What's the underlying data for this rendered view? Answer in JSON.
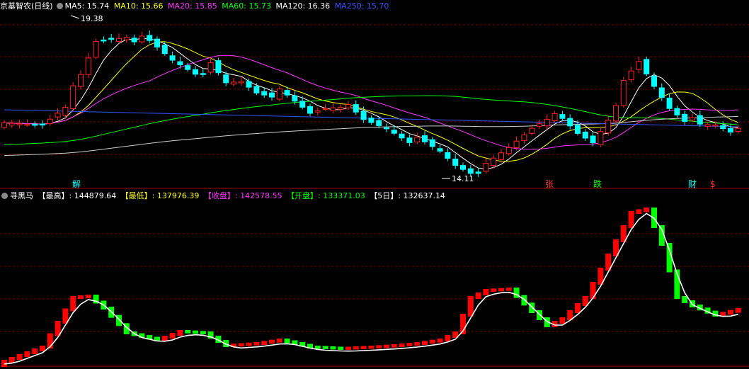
{
  "header_top": {
    "stock_name": "京基智农(日线)",
    "ma_labels": [
      {
        "text": "MA5: 15.74",
        "color": "#ffffff"
      },
      {
        "text": "MA10: 15.66",
        "color": "#ffff00"
      },
      {
        "text": "MA20: 15.85",
        "color": "#ff33ff"
      },
      {
        "text": "MA60: 15.73",
        "color": "#00ff00"
      },
      {
        "text": "MA120: 16.36",
        "color": "#ffffff"
      },
      {
        "text": "MA250: 15.70",
        "color": "#3355ff"
      }
    ]
  },
  "header_bottom": {
    "indicator_name": "寻黑马",
    "stats": [
      {
        "text": "【最高】: 144879.64",
        "color": "#ffffff"
      },
      {
        "text": "【最低】: 137976.39",
        "color": "#ffff00"
      },
      {
        "text": "【收盘】: 142578.55",
        "color": "#ff33ff"
      },
      {
        "text": "【开盘】: 133371.03",
        "color": "#00ff00"
      },
      {
        "text": "【5日】: 132637.14",
        "color": "#ffffff"
      }
    ]
  },
  "colors": {
    "up": "#ff2222",
    "down": "#00ffff",
    "ind_up": "#ff0000",
    "ind_down": "#00ff00",
    "grid": "#7a0000",
    "axis": "#aa0000"
  },
  "chart_data": [
    {
      "type": "candlestick",
      "series": [
        {
          "name": "MA5"
        },
        {
          "name": "MA10"
        },
        {
          "name": "MA20"
        },
        {
          "name": "MA60"
        },
        {
          "name": "MA120"
        },
        {
          "name": "MA250"
        }
      ],
      "annotations": [
        "19.38",
        "14.11"
      ],
      "event_labels": [
        {
          "text": "解",
          "color": "#00ffff"
        },
        {
          "text": "张",
          "color": "#ff3333"
        },
        {
          "text": "跌",
          "color": "#00ff00"
        },
        {
          "text": "财",
          "color": "#00ffff"
        },
        {
          "text": "$",
          "color": "#ff3333"
        }
      ],
      "grid": true
    },
    {
      "type": "bar",
      "title": "寻黑马",
      "grid": true
    }
  ]
}
